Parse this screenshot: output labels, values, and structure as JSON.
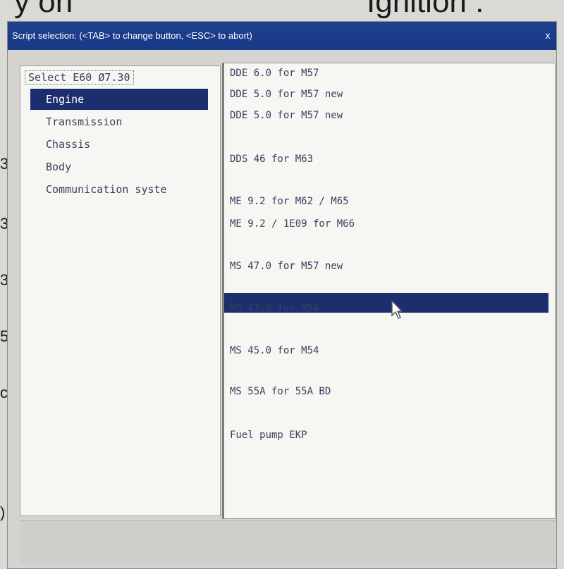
{
  "background": {
    "top_left": "y on",
    "top_right": "Ignition :",
    "edge_chars": [
      "3",
      "3",
      "3",
      "5",
      "c",
      ")"
    ]
  },
  "window": {
    "title": "Script selection: (<TAB> to change button, <ESC> to abort)",
    "close_label": "x"
  },
  "tree": {
    "root": "Select E60 Ø7.30",
    "items": [
      {
        "label": "Engine",
        "selected": true
      },
      {
        "label": "Transmission",
        "selected": false
      },
      {
        "label": "Chassis",
        "selected": false
      },
      {
        "label": "Body",
        "selected": false
      },
      {
        "label": "Communication syste",
        "selected": false
      }
    ]
  },
  "scripts": [
    "DDE 6.0  for M57",
    "DDE 5.0  for M57 new",
    "DDE 5.0  for M57 new",
    "DDS 46   for M63",
    "ME  9.2  for M62 / M65",
    "ME  9.2 / 1E09 for M66",
    "MS 47.0  for M57 new",
    "MS 43.0  for M54",
    "MS 45.0  for M54",
    "MS  55A  for 55A BD",
    "Fuel pump EKP"
  ],
  "colors": {
    "titlebar": "#1e3e8f",
    "selection": "#1c2e6e",
    "panel": "#f6f6f3",
    "window": "#d4d3cf"
  },
  "icons": {
    "cursor": "mouse-pointer-icon",
    "close": "close-icon"
  }
}
